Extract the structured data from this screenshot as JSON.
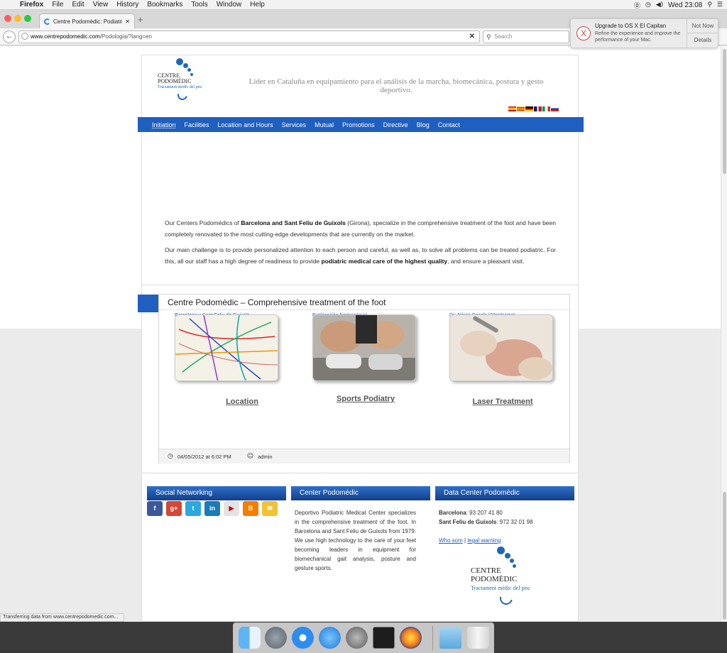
{
  "menubar": {
    "items": [
      "Firefox",
      "File",
      "Edit",
      "View",
      "History",
      "Bookmarks",
      "Tools",
      "Window",
      "Help"
    ],
    "clock": "Wed 23:08"
  },
  "browser": {
    "tab_title": "Centre Podomèdic: Podiatri...",
    "url_host": "www.centrepodomedic.com",
    "url_path": "/Podologia/?lang=en",
    "search_placeholder": "Search"
  },
  "notification": {
    "title": "Upgrade to OS X El Capitan",
    "body": "Refine the experience and improve the performance of your Mac.",
    "not_now": "Not Now",
    "details": "Details"
  },
  "site": {
    "logo": {
      "line1": "CENTRE",
      "line2": "PODOMÈDIC",
      "sub": "Tractament mèdic del peu"
    },
    "tagline": "Líder en Cataluña en equipamiento para el análisis de la marcha, biomecánica, postura y gesto deportivo.",
    "nav": [
      "Initiation",
      "Facilities",
      "Location and Hours",
      "Services",
      "Mutual",
      "Promotions",
      "Directive",
      "Blog",
      "Contact"
    ],
    "intro": {
      "p1_a": "Our Centers Podomédics of ",
      "p1_b": "Barcelona and Sant Feliu de Guixols",
      "p1_c": " (Girona), specialize in the comprehensive treatment of the foot and have been completely renovated to the most cutting-edge developments that are currently on the market.",
      "p2_a": "Our main challenge is to provide personalized attention to each person and careful, as well as, to solve all problems can be treated podiatric. For this, all our staff has a high degree of readiness to provide ",
      "p2_b": "podiatric medical care of the highest quality",
      "p2_c": ", and ensure a pleasant visit."
    },
    "post": {
      "title": "Centre Podomèdic – Comprehensive treatment of the foot",
      "cards": [
        {
          "caption": "Barcelona y Sant Feliu de Guixols",
          "link": "Location"
        },
        {
          "caption": "Exploración biomecánica",
          "link": "Sports Podiatry"
        },
        {
          "caption": "Dr. Alèxia Casals i Montserrat",
          "link": "Laser Treatment"
        }
      ],
      "date": "04/05/2012 at 6:02 PM",
      "author": "admin"
    },
    "footer": {
      "social_title": "Social Networking",
      "center_title": "Center Podomèdic",
      "data_title": "Data Center Podomèdic",
      "center_text": "Deportivo Podiatric Medical Center specializes in the comprehensive treatment of the foot. In Barcelona and Sant Feliu de Guixols from 1979. We use high technology to the care of your feet becoming leaders in equipment for biomechanical gait analysis, posture and gesture sports.",
      "bcn_label": "Barcelona",
      "bcn_phone": ": 93 207 41 80",
      "sfg_label": "Sant Feliu de Guixols",
      "sfg_phone": ": 972 32 01 98",
      "who": "Who som",
      "sep": "|",
      "legal": "legal warning"
    }
  },
  "status_text": "Transferring data from www.centrepodomedic.com..."
}
